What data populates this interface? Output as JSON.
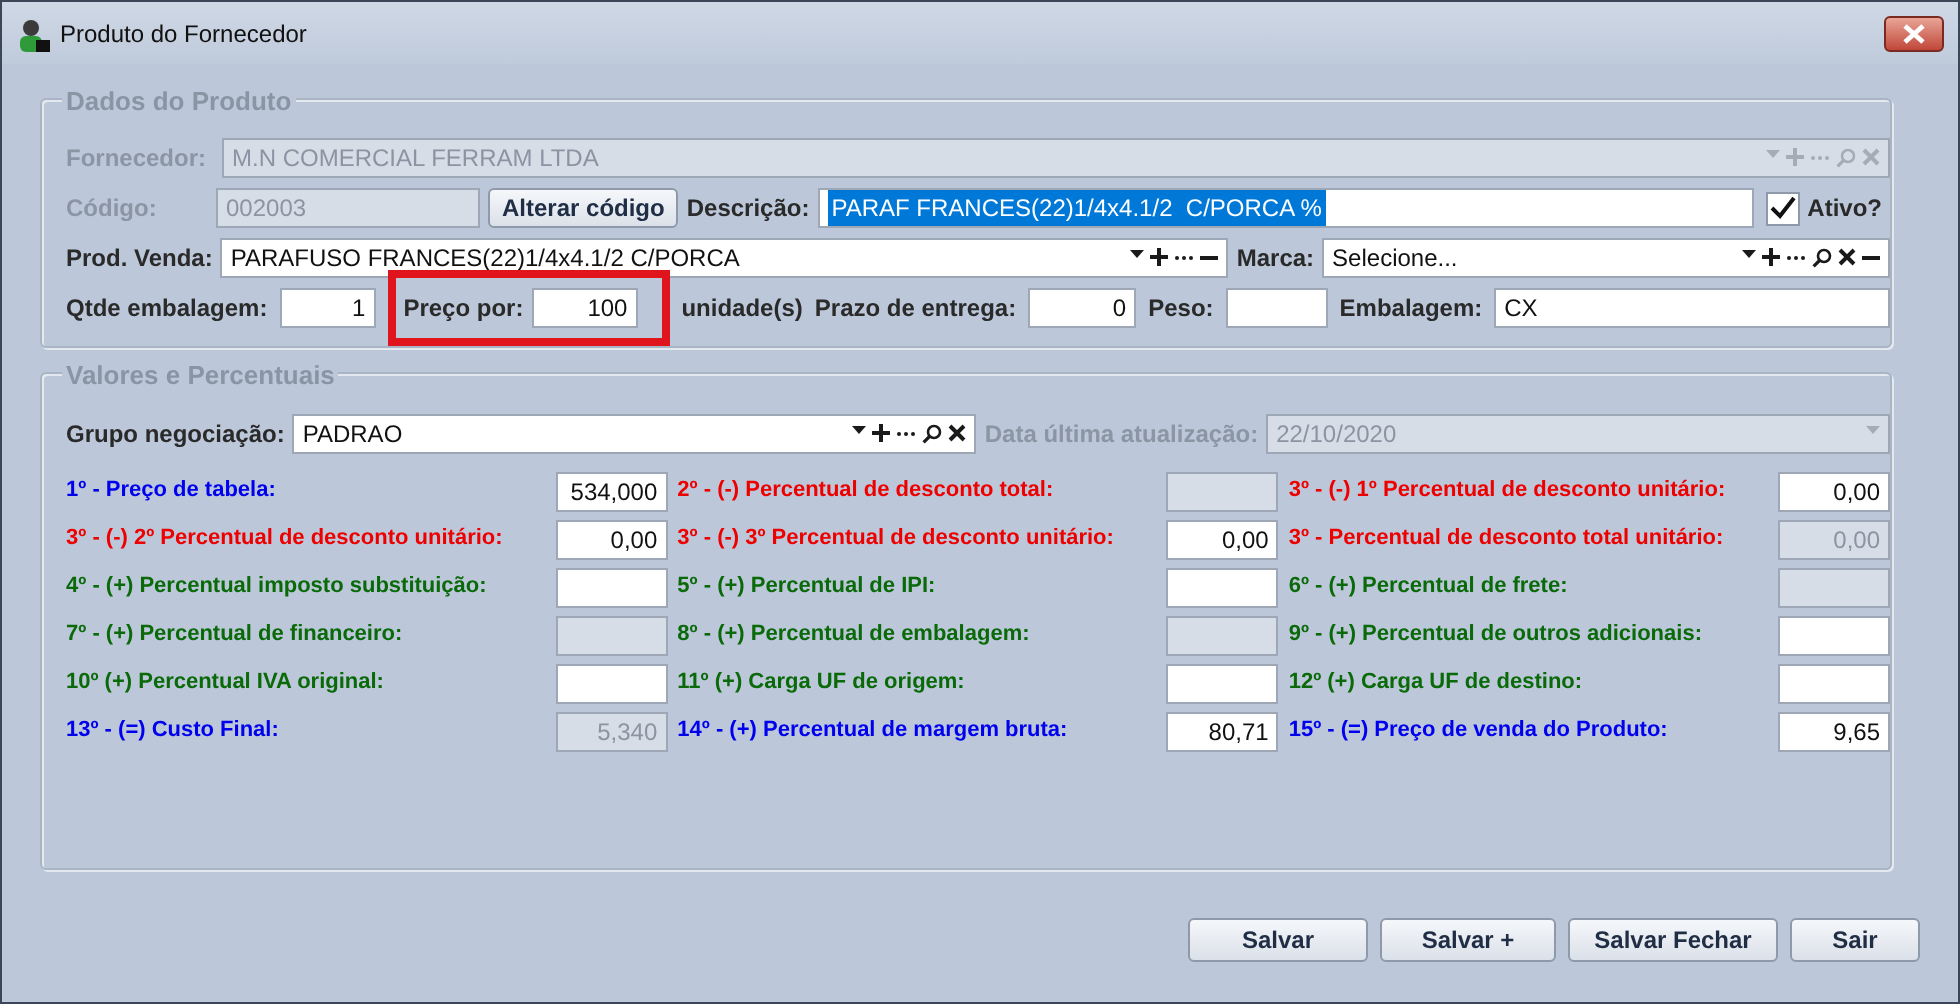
{
  "window": {
    "title": "Produto do Fornecedor"
  },
  "dados_produto": {
    "title": "Dados do Produto",
    "fornecedor": {
      "label": "Fornecedor:",
      "value": "M.N COMERCIAL FERRAM LTDA",
      "disabled": true,
      "tools": [
        {
          "kind": "dropdown"
        },
        {
          "kind": "add"
        },
        {
          "kind": "more"
        },
        {
          "kind": "search"
        },
        {
          "kind": "clear"
        }
      ]
    },
    "codigo": {
      "label": "Código:",
      "value": "002003",
      "disabled": true
    },
    "alterar_codigo": "Alterar código",
    "descricao": {
      "label": "Descrição:",
      "value": "PARAF FRANCES(22)1/4x4.1/2  C/PORCA %",
      "selected": true
    },
    "ativo": {
      "label": "Ativo?",
      "checked": true
    },
    "prod_venda": {
      "label": "Prod. Venda:",
      "value": "PARAFUSO FRANCES(22)1/4x4.1/2 C/PORCA",
      "disabled": false,
      "tools": [
        {
          "kind": "dropdown"
        },
        {
          "kind": "add"
        },
        {
          "kind": "more"
        },
        {
          "kind": "remove"
        }
      ]
    },
    "marca": {
      "label": "Marca:",
      "value": "Selecione...",
      "disabled": false,
      "tools": [
        {
          "kind": "dropdown"
        },
        {
          "kind": "add"
        },
        {
          "kind": "more"
        },
        {
          "kind": "search"
        },
        {
          "kind": "clear"
        },
        {
          "kind": "remove"
        }
      ]
    },
    "fields": [
      {
        "label": "Qtde embalagem:",
        "value": "1",
        "highlighted": false
      },
      {
        "label": "Preço por:",
        "value": "100",
        "unit": "unidade(s)",
        "highlighted": true
      },
      {
        "label": "Prazo de entrega:",
        "value": "0",
        "highlighted": false
      },
      {
        "label": "Peso:",
        "highlighted": false
      },
      {
        "label": "Embalagem:",
        "value": "CX",
        "highlighted": false
      }
    ]
  },
  "valores": {
    "title": "Valores e Percentuais",
    "grupo": {
      "label": "Grupo negociação:",
      "value": "PADRAO",
      "disabled": false,
      "tools": [
        {
          "kind": "dropdown"
        },
        {
          "kind": "add"
        },
        {
          "kind": "more"
        },
        {
          "kind": "search"
        },
        {
          "kind": "clear"
        }
      ]
    },
    "data_atualizacao": {
      "label": "Data última atualização:",
      "value": "22/10/2020",
      "disabled": true,
      "tools": [
        {
          "kind": "dropdown"
        }
      ]
    },
    "cells": [
      {
        "label": "1º - Preço de tabela:",
        "color": "#0000ee",
        "value": "534,000",
        "disabled": false
      },
      {
        "label": "2º - (-) Percentual de desconto total:",
        "color": "#ee0000",
        "disabled": true
      },
      {
        "label": "3º - (-) 1º Percentual de desconto unitário:",
        "color": "#ee0000",
        "value": "0,00",
        "disabled": false
      },
      {
        "label": "3º - (-) 2º Percentual de desconto unitário:",
        "color": "#ee0000",
        "value": "0,00",
        "disabled": false
      },
      {
        "label": "3º - (-) 3º Percentual de desconto unitário:",
        "color": "#ee0000",
        "value": "0,00",
        "disabled": false
      },
      {
        "label": "3º - Percentual de desconto total unitário:",
        "color": "#ee0000",
        "value": "0,00",
        "disabled": true
      },
      {
        "label": "4º - (+) Percentual imposto substituição:",
        "color": "#0a6a0a",
        "disabled": false
      },
      {
        "label": "5º - (+) Percentual de IPI:",
        "color": "#0a6a0a",
        "disabled": false
      },
      {
        "label": "6º - (+) Percentual de frete:",
        "color": "#0a6a0a",
        "disabled": true
      },
      {
        "label": "7º - (+) Percentual de financeiro:",
        "color": "#0a6a0a",
        "disabled": true
      },
      {
        "label": "8º - (+) Percentual de embalagem:",
        "color": "#0a6a0a",
        "disabled": true
      },
      {
        "label": "9º - (+) Percentual de outros adicionais:",
        "color": "#0a6a0a",
        "disabled": false
      },
      {
        "label": "10º (+) Percentual IVA original:",
        "color": "#0a6a0a",
        "disabled": false
      },
      {
        "label": "11º (+) Carga UF de origem:",
        "color": "#0a6a0a",
        "disabled": false
      },
      {
        "label": "12º (+) Carga UF de destino:",
        "color": "#0a6a0a",
        "disabled": false
      },
      {
        "label": "13º - (=) Custo Final:",
        "color": "#0000ee",
        "value": "5,340",
        "disabled": true
      },
      {
        "label": "14º - (+) Percentual de margem bruta:",
        "color": "#0000ee",
        "value": "80,71",
        "disabled": false
      },
      {
        "label": "15º - (=) Preço de venda do Produto:",
        "color": "#0000ee",
        "value": "9,65",
        "disabled": false
      }
    ]
  },
  "buttons": [
    "Salvar",
    "Salvar +",
    "Salvar Fechar",
    "Sair"
  ]
}
